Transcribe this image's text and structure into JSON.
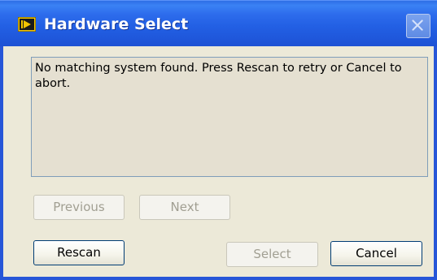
{
  "window": {
    "title": "Hardware Select",
    "app_icon": "labview-icon",
    "close_icon": "close-icon"
  },
  "message": {
    "text": "No matching system found. Press Rescan to retry or Cancel to abort."
  },
  "buttons": {
    "previous_label": "Previous",
    "next_label": "Next",
    "rescan_label": "Rescan",
    "select_label": "Select",
    "cancel_label": "Cancel"
  },
  "colors": {
    "titlebar": "#2360e4",
    "window_background": "#ece9d8",
    "message_background": "#e5e0d1",
    "disabled_text": "#a19f92",
    "button_border": "#003c74"
  }
}
